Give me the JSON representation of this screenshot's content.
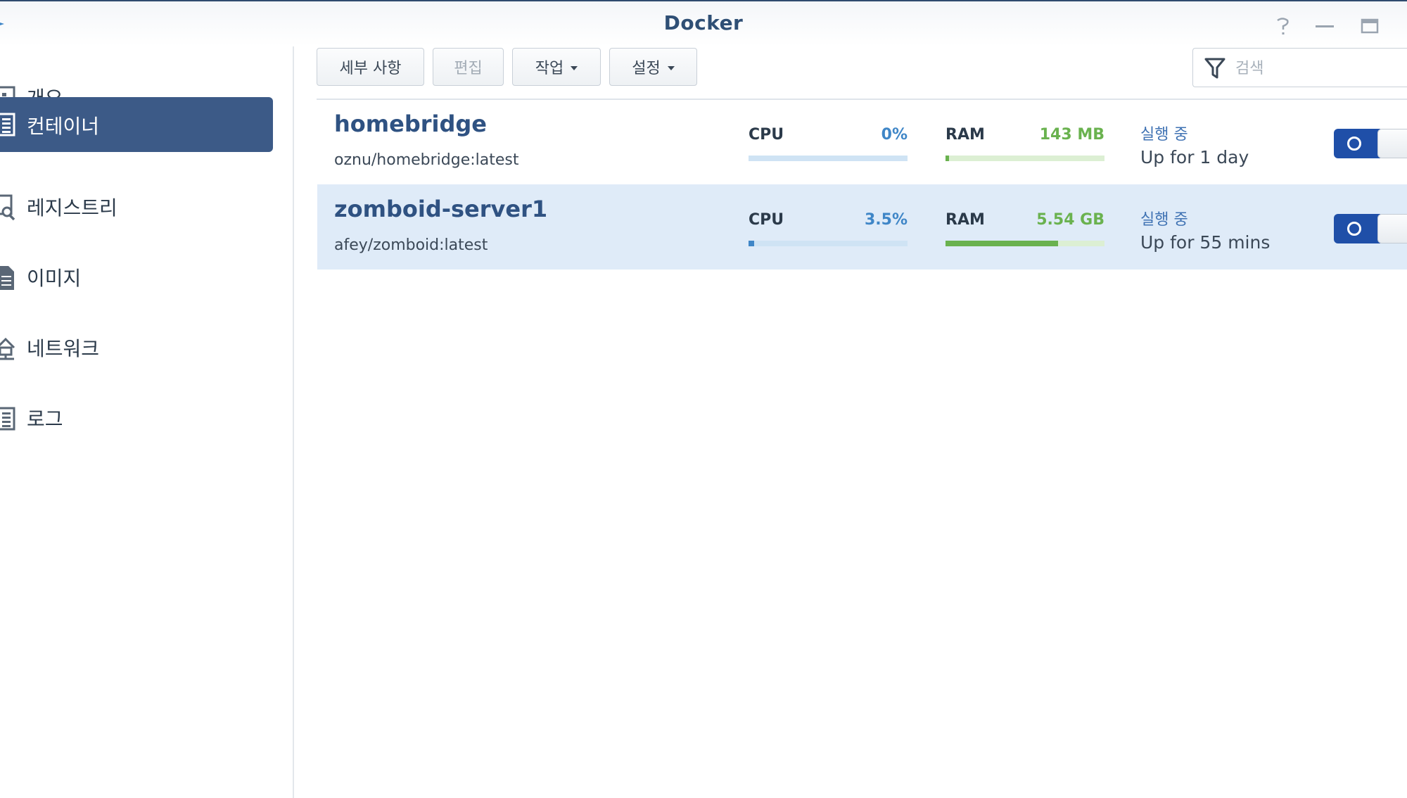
{
  "window": {
    "title": "Docker"
  },
  "sidebar": {
    "items": [
      {
        "label": "개요",
        "icon": "overview-icon",
        "active": false
      },
      {
        "label": "컨테이너",
        "icon": "container-icon",
        "active": true
      },
      {
        "label": "레지스트리",
        "icon": "registry-search-icon",
        "active": false
      },
      {
        "label": "이미지",
        "icon": "image-file-icon",
        "active": false
      },
      {
        "label": "네트워크",
        "icon": "network-house-icon",
        "active": false
      },
      {
        "label": "로그",
        "icon": "log-list-icon",
        "active": false
      }
    ]
  },
  "toolbar": {
    "details_label": "세부 사항",
    "edit_label": "편집",
    "action_label": "작업",
    "settings_label": "설정",
    "search_placeholder": "검색",
    "search_value": ""
  },
  "containers": [
    {
      "name": "homebridge",
      "image": "oznu/homebridge:latest",
      "cpu_label": "CPU",
      "cpu_value": "0%",
      "cpu_fraction": 0.0,
      "ram_label": "RAM",
      "ram_value": "143 MB",
      "ram_fraction": 0.02,
      "status": "실행 중",
      "uptime": "Up for 1 day",
      "running": true,
      "selected": false
    },
    {
      "name": "zomboid-server1",
      "image": "afey/zomboid:latest",
      "cpu_label": "CPU",
      "cpu_value": "3.5%",
      "cpu_fraction": 0.035,
      "ram_label": "RAM",
      "ram_value": "5.54 GB",
      "ram_fraction": 0.71,
      "status": "실행 중",
      "uptime": "Up for 55 mins",
      "running": true,
      "selected": true
    }
  ],
  "colors": {
    "accent": "#3c5a87",
    "cpu": "#3f86c7",
    "ram": "#6ab24f",
    "toggle_on": "#1f4fa8",
    "selected_row": "#dfebf8"
  }
}
